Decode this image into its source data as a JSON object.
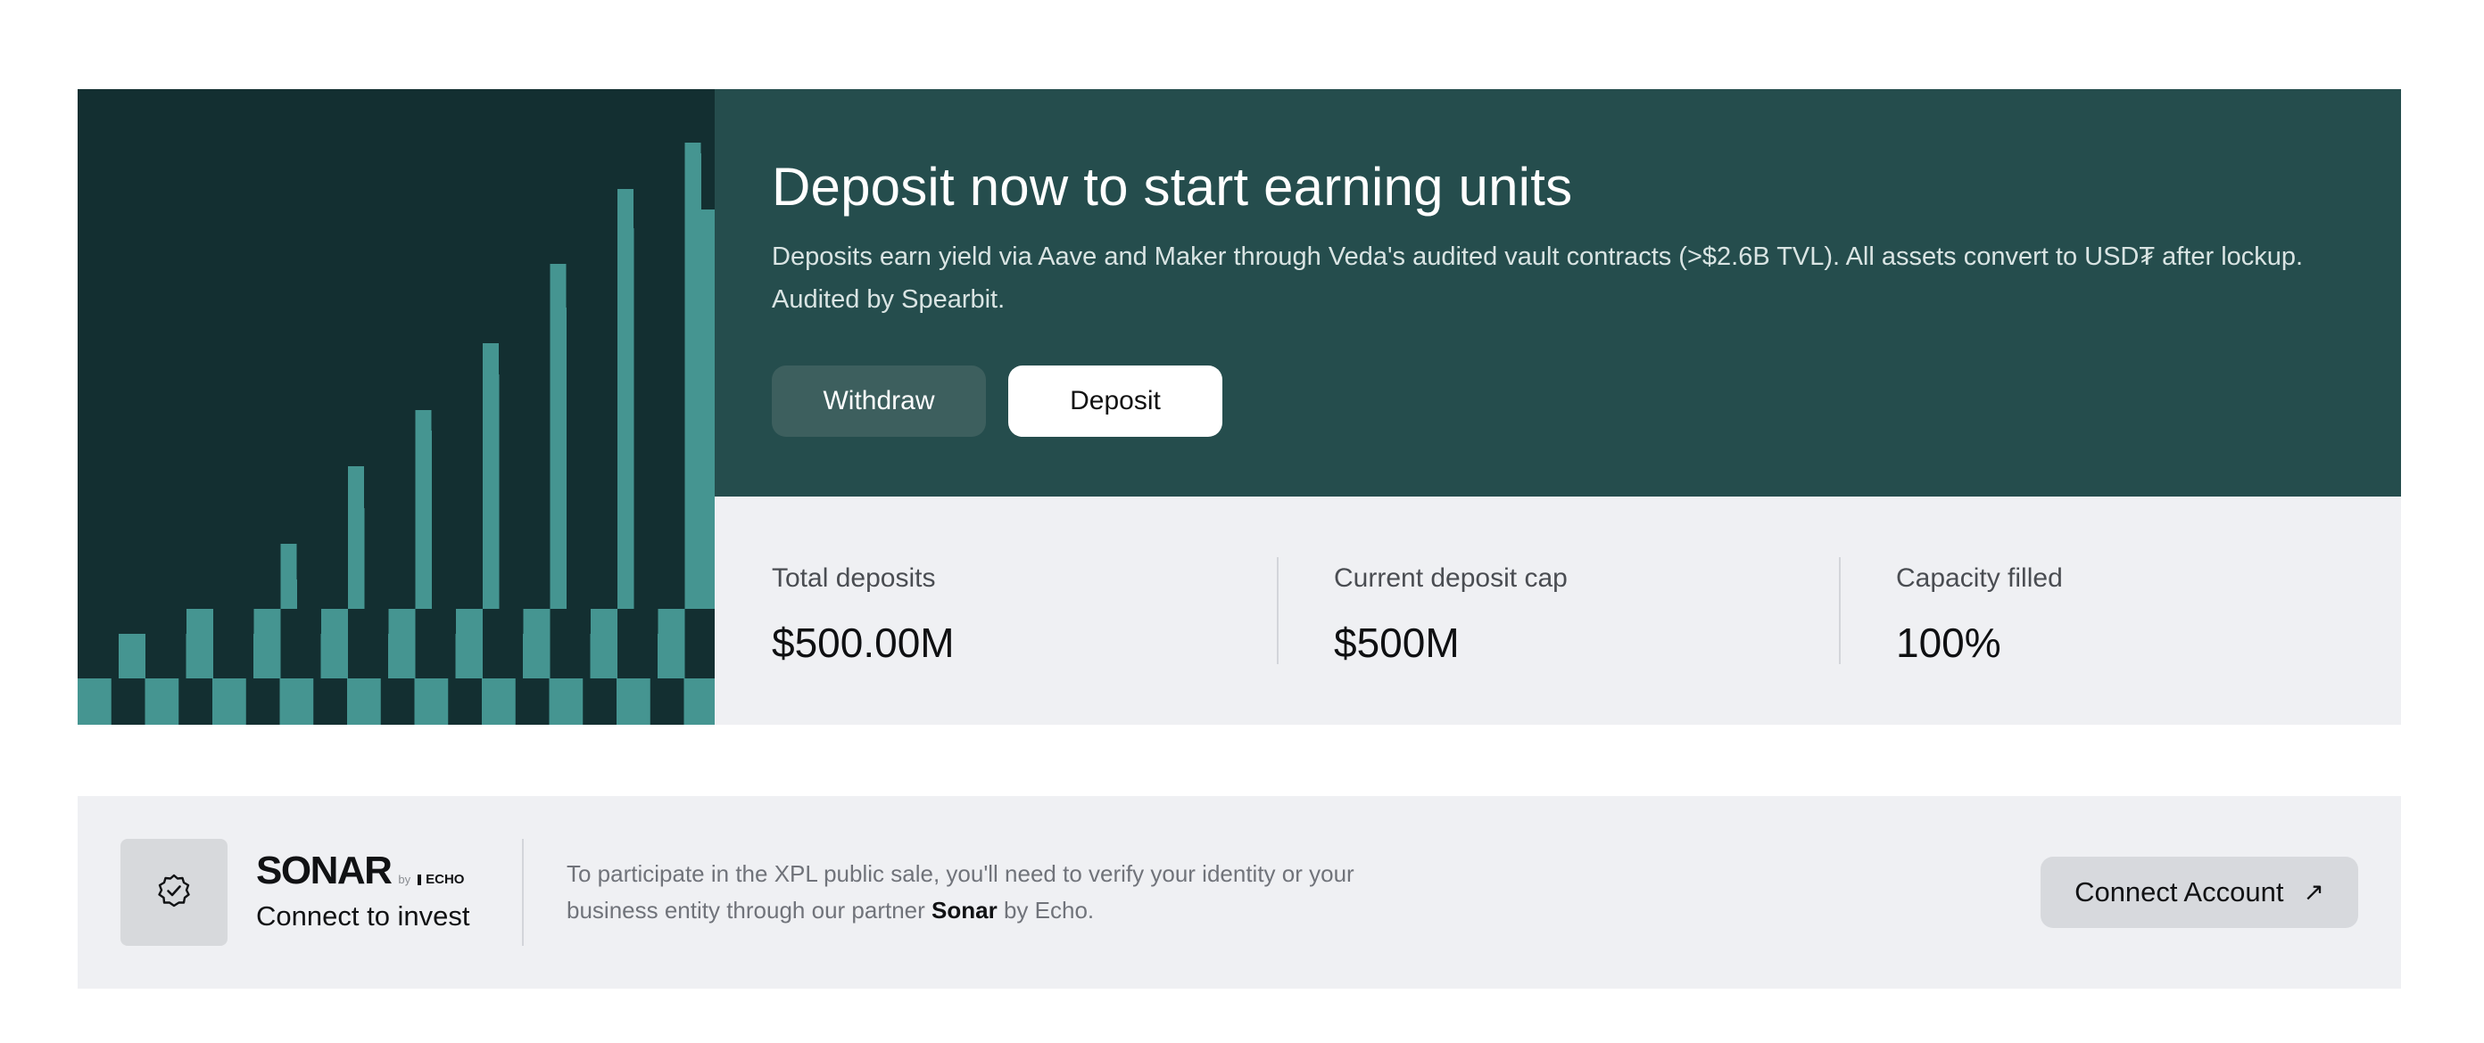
{
  "hero": {
    "title": "Deposit now to start earning units",
    "description": "Deposits earn yield via Aave and Maker through Veda's audited vault contracts (>$2.6B TVL). All assets convert to USD₮ after lockup. Audited by Spearbit.",
    "withdraw_label": "Withdraw",
    "deposit_label": "Deposit"
  },
  "stats": [
    {
      "label": "Total deposits",
      "value": "$500.00M"
    },
    {
      "label": "Current deposit cap",
      "value": "$500M"
    },
    {
      "label": "Capacity filled",
      "value": "100%"
    }
  ],
  "sonar": {
    "brand": "SONAR",
    "by": "by",
    "partner_logo": "ECHO",
    "subtitle": "Connect to invest",
    "text_before": "To participate in the XPL public sale, you'll need to verify your identity or your business entity through our partner",
    "text_strong": "Sonar",
    "text_after": "by Echo.",
    "button_label": "Connect Account",
    "badge_icon": "verified-badge-icon",
    "arrow_icon": "arrow-up-right-icon"
  },
  "colors": {
    "art_bg": "#132f31",
    "art_fg": "#459591",
    "hero_bg": "#254d4d",
    "stats_bg": "#eff0f3"
  }
}
